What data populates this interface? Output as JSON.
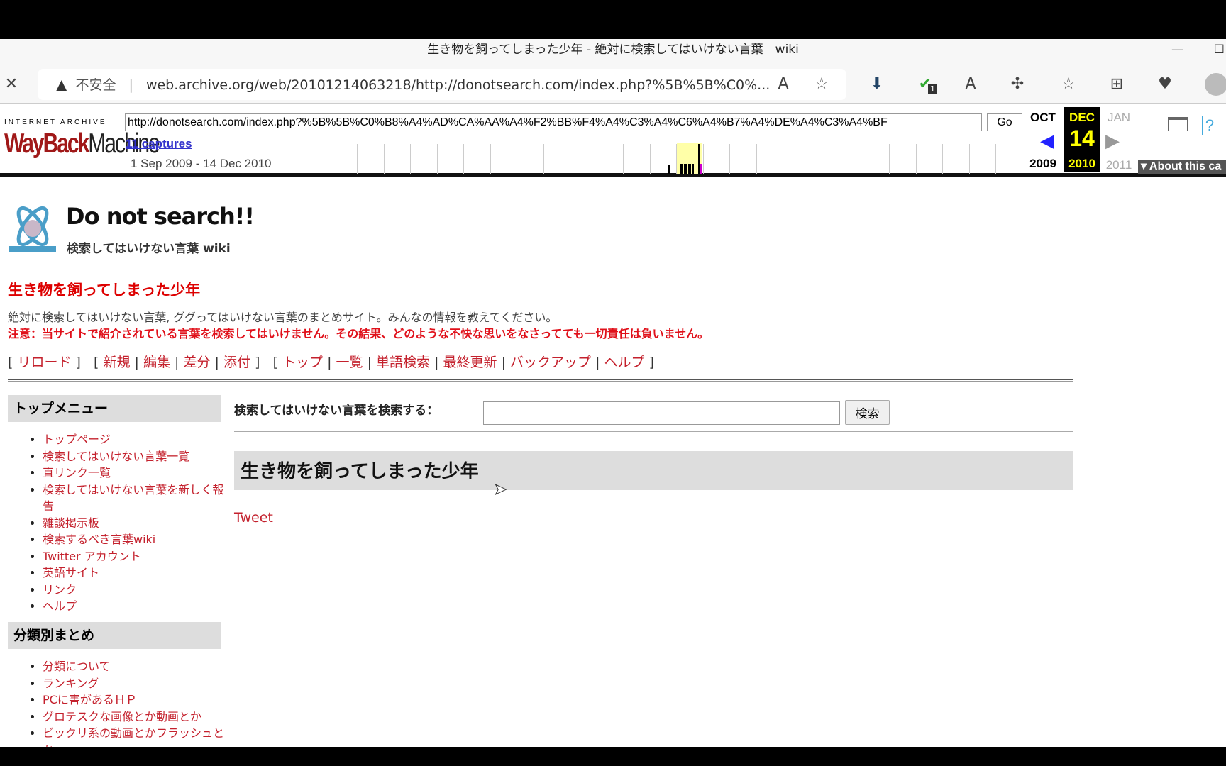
{
  "browser": {
    "window_title": "生き物を飼ってしまった少年 - 絶対に検索してはいけない言葉　wiki",
    "security_label": "不安全",
    "url": "web.archive.org/web/20101214063218/http://donotsearch.com/index.php?%5B%5B%C0%...",
    "icons": [
      "close-icon",
      "warning-icon",
      "read-aloud-icon",
      "add-favorite-icon",
      "download-extension-icon",
      "shield-extension-icon",
      "translate-icon",
      "extensions-icon",
      "favorites-icon",
      "collections-icon",
      "health-icon",
      "profile-icon"
    ],
    "extension_badge": "1"
  },
  "wayback": {
    "brand_top": "INTERNET ARCHIVE",
    "brand": "WayBackMachine",
    "url_input": "http://donotsearch.com/index.php?%5B%5B%C0%B8%A4%AD%CA%AA%A4%F2%BB%F4%A4%C3%A4%C6%A4%B7%A4%DE%A4%C3%A4%BF",
    "go": "Go",
    "captures": "11 captures",
    "range": "1 Sep 2009 - 14 Dec 2010",
    "prev_month": "OCT",
    "cur_month": "DEC",
    "next_month": "JAN",
    "day": "14",
    "prev_year": "2009",
    "cur_year": "2010",
    "next_year": "2011",
    "help": "?",
    "about": "▾ About this ca"
  },
  "site": {
    "logo_title": "Do not search!!",
    "logo_sub": "検索してはいけない言葉 wiki",
    "logo_mark": "PUKIWIKI",
    "page_title": "生き物を飼ってしまった少年",
    "description": "絶対に検索してはいけない言葉, ググってはいけない言葉のまとめサイト。みんなの情報を教えてください。",
    "warning": "注意：当サイトで紹介されている言葉を検索してはいけません。その結果、どのような不快な思いをなさってても一切責任は負いません。",
    "nav": [
      "リロード",
      "新規",
      "編集",
      "差分",
      "添付",
      "トップ",
      "一覧",
      "単語検索",
      "最終更新",
      "バックアップ",
      "ヘルプ"
    ]
  },
  "sidebar": {
    "menu_title": "トップメニュー",
    "menu_items": [
      "トップページ",
      "検索してはいけない言葉一覧",
      "直リンク一覧",
      "検索してはいけない言葉を新しく報告",
      "雑談掲示板",
      "検索するべき言葉wiki",
      "Twitter アカウント",
      "英語サイト",
      "リンク",
      "ヘルプ"
    ],
    "category_title": "分類別まとめ",
    "category_items": [
      "分類について",
      "ランキング",
      "PCに害があるＨＰ",
      "グロテスクな画像とか動画とか",
      "ビックリ系の動画とかフラッシュとか"
    ]
  },
  "main": {
    "search_label": "検索してはいけない言葉を検索する：",
    "search_value": "",
    "search_button": "検索",
    "heading": "生き物を飼ってしまった少年",
    "tweet": "Tweet"
  }
}
